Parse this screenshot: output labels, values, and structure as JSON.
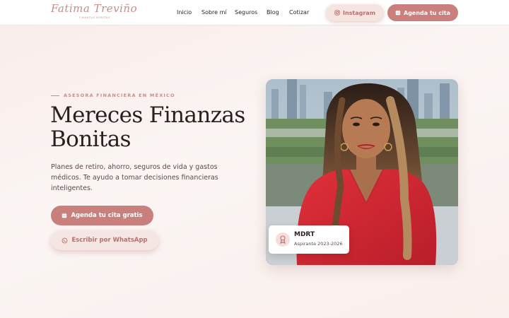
{
  "header": {
    "logo_text": "Fatima Treviño",
    "logo_tagline": "Finanzas Bonitas",
    "nav": [
      {
        "label": "Inicio"
      },
      {
        "label": "Sobre mí"
      },
      {
        "label": "Seguros"
      },
      {
        "label": "Blog"
      },
      {
        "label": "Cotizar"
      }
    ],
    "instagram_label": "Instagram",
    "agenda_label": "Agenda tu cita"
  },
  "hero": {
    "eyebrow": "ASESORA FINANCIERA EN MÉXICO",
    "title_line1": "Mereces Finanzas",
    "title_line2": "Bonitas",
    "description": "Planes de retiro, ahorro, seguros de vida y gastos médicos. Te ayudo a tomar decisiones financieras inteligentes.",
    "cta_primary": "Agenda tu cita gratis",
    "cta_secondary": "Escribir por WhatsApp"
  },
  "badge": {
    "title": "MDRT",
    "subtitle": "Aspirante 2023-2026"
  },
  "icons": {
    "instagram": "instagram-icon",
    "calendar": "calendar-icon",
    "whatsapp": "whatsapp-icon",
    "award": "award-icon"
  },
  "colors": {
    "accent": "#c9807d",
    "accent_light": "#f6e4e1",
    "text_dark": "#2a1f1f",
    "background": "#f9efec"
  }
}
